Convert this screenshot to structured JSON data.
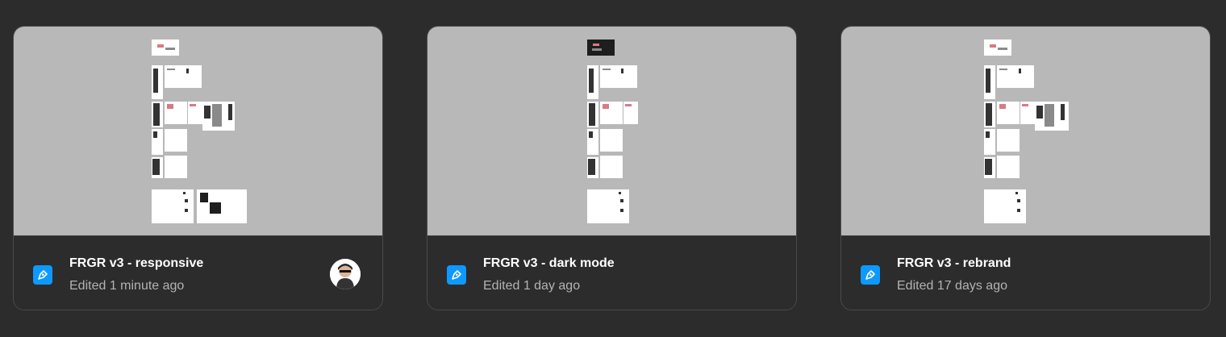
{
  "files": [
    {
      "title": "FRGR v3 - responsive",
      "edited": "Edited 1 minute ago",
      "icon": "figma-file-icon",
      "has_avatar": true
    },
    {
      "title": "FRGR v3 - dark mode",
      "edited": "Edited 1 day ago",
      "icon": "figma-file-icon",
      "has_avatar": false
    },
    {
      "title": "FRGR v3 - rebrand",
      "edited": "Edited 17 days ago",
      "icon": "figma-file-icon",
      "has_avatar": false
    }
  ],
  "colors": {
    "background": "#2c2c2c",
    "thumbnail_bg": "#b8b8b8",
    "file_icon": "#0d99ff",
    "title": "#ffffff",
    "subtitle": "#b3b3b3"
  }
}
